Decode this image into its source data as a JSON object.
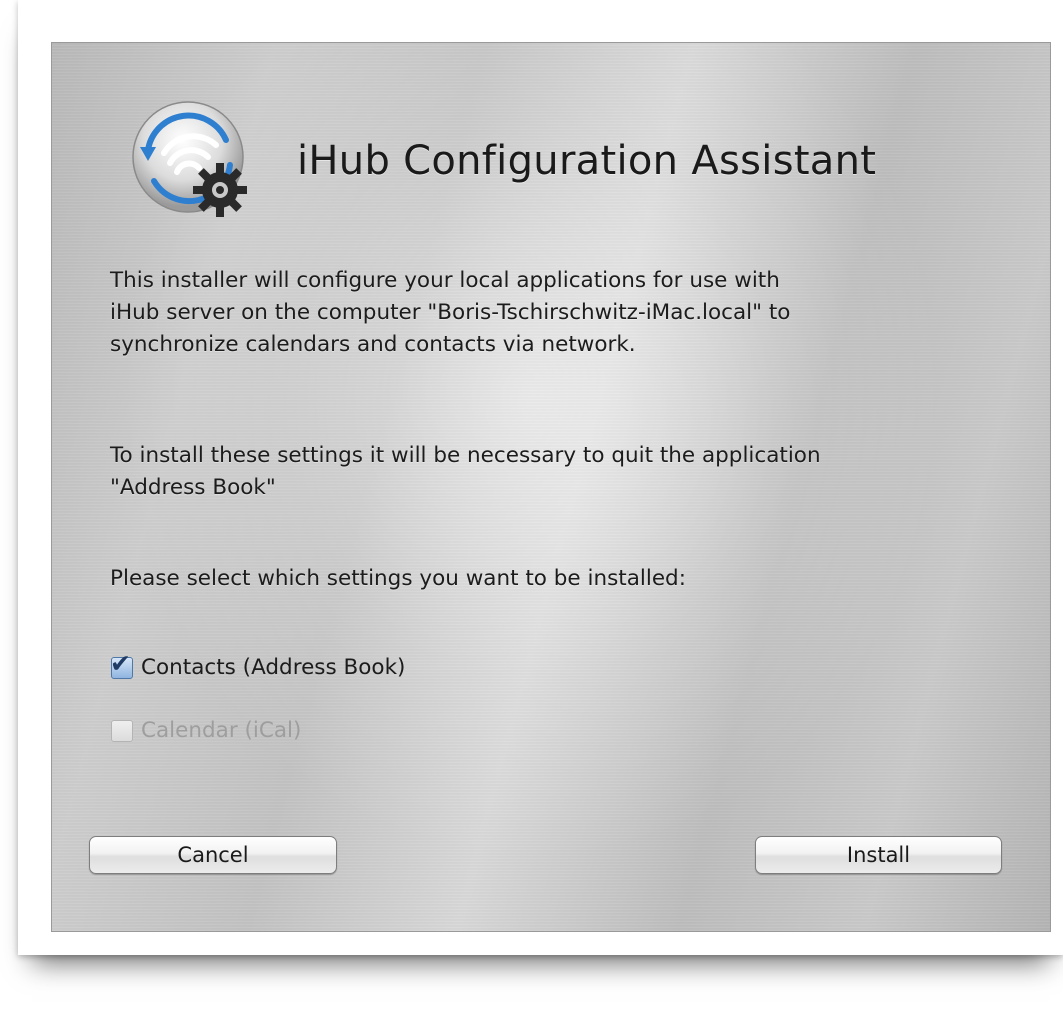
{
  "dialog": {
    "title": "iHub Configuration Assistant",
    "icon": "ihub-wifi-gear-icon",
    "paragraph1": [
      "This installer will configure your local applications for use with",
      "iHub server on the computer \"Boris-Tschirschwitz-iMac.local\" to",
      "synchronize calendars and contacts via network."
    ],
    "paragraph2": [
      "To install these settings it will be necessary to quit the application",
      "\"Address Book\""
    ],
    "prompt": "Please select which settings you want to be installed:",
    "options": [
      {
        "label": "Contacts (Address Book)",
        "checked": true,
        "enabled": true
      },
      {
        "label": "Calendar (iCal)",
        "checked": false,
        "enabled": false
      }
    ],
    "buttons": {
      "cancel": "Cancel",
      "install": "Install"
    }
  },
  "colors": {
    "icon_ring": "#2f7fd0",
    "checkbox_checked": "#8fb4e0",
    "disabled_text": "#9e9e9e"
  }
}
